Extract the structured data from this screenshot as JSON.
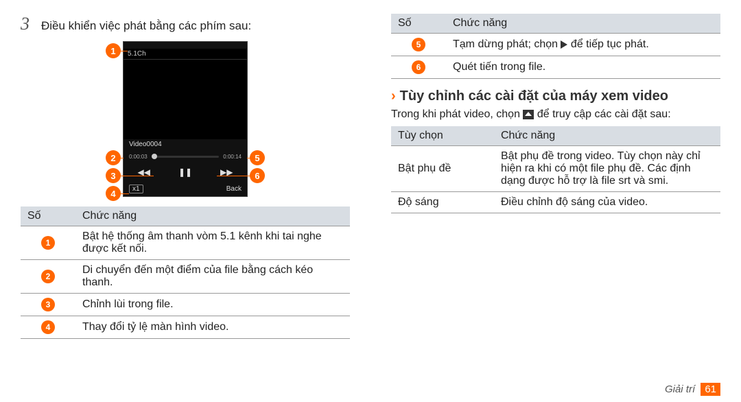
{
  "left": {
    "step_num": "3",
    "step_text": "Điều khiển việc phát bằng các phím sau:",
    "phone": {
      "status": "5.1Ch",
      "title": "Video0004",
      "t1": "0:00:03",
      "t2": "0:00:14",
      "x1": "x1",
      "back": "Back"
    },
    "table1": {
      "h1": "Số",
      "h2": "Chức năng",
      "rows": [
        [
          "1",
          "Bật hệ thống âm thanh vòm 5.1 kênh khi tai nghe được kết nối."
        ],
        [
          "2",
          "Di chuyển đến một điểm của file bằng cách kéo thanh."
        ],
        [
          "3",
          "Chỉnh lùi trong file."
        ],
        [
          "4",
          "Thay đổi tỷ lệ màn hình video."
        ]
      ]
    }
  },
  "right": {
    "table1": {
      "h1": "Số",
      "h2": "Chức năng",
      "rows": [
        [
          "5",
          "Tạm dừng phát; chọn ▶ để tiếp tục phát."
        ],
        [
          "6",
          "Quét tiến trong file."
        ]
      ]
    },
    "section_title": "Tùy chỉnh các cài đặt của máy xem video",
    "body1a": "Trong khi phát video, chọn ",
    "body1b": " để truy cập các cài đặt sau:",
    "table2": {
      "h1": "Tùy chọn",
      "h2": "Chức năng",
      "rows": [
        [
          "Bật phụ đề",
          "Bật phụ đề trong video. Tùy chọn này chỉ hiện ra khi có một file phụ đề. Các định dạng được hỗ trợ là file srt và smi."
        ],
        [
          "Độ sáng",
          "Điều chỉnh độ sáng của video."
        ]
      ]
    }
  },
  "footer": {
    "section": "Giải trí",
    "page": "61"
  }
}
